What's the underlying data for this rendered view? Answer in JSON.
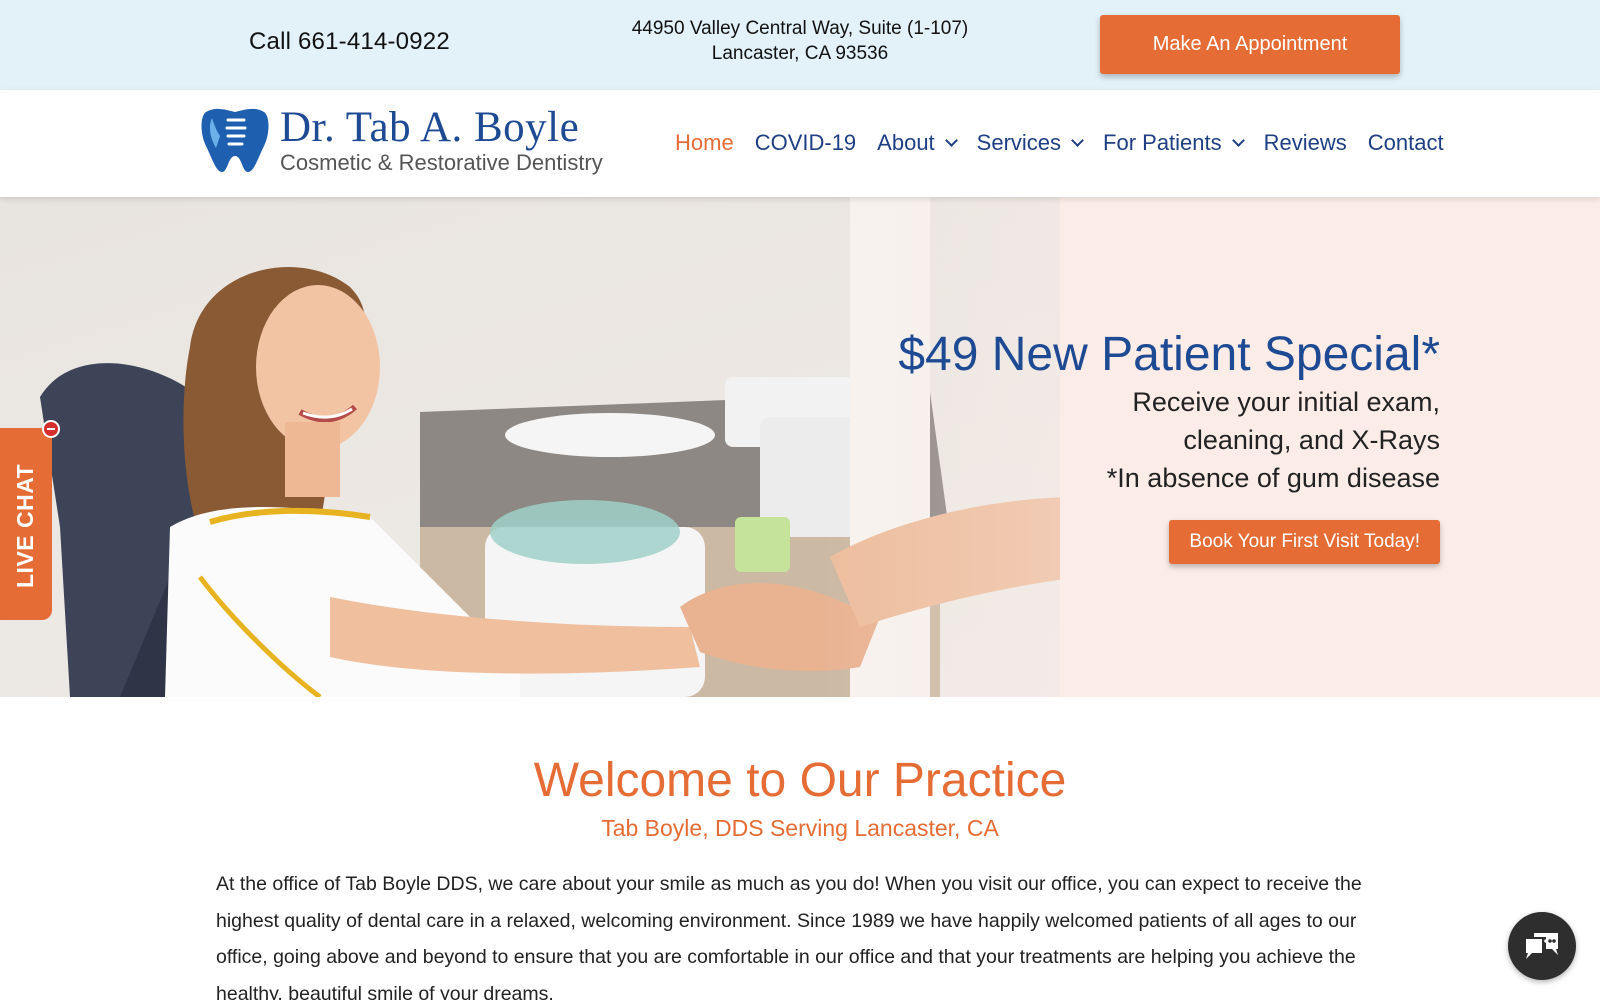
{
  "topbar": {
    "phone": "Call 661-414-0922",
    "address_line1": "44950 Valley Central Way, Suite (1-107)",
    "address_line2": "Lancaster, CA 93536",
    "appointment_button": "Make An Appointment"
  },
  "header": {
    "logo_name": "Dr. Tab A. Boyle",
    "logo_tagline": "Cosmetic & Restorative Dentistry",
    "nav": [
      {
        "label": "Home",
        "active": true
      },
      {
        "label": "COVID-19"
      },
      {
        "label": "About",
        "dropdown": true
      },
      {
        "label": "Services",
        "dropdown": true
      },
      {
        "label": "For Patients",
        "dropdown": true
      },
      {
        "label": "Reviews"
      },
      {
        "label": "Contact"
      }
    ]
  },
  "hero": {
    "promo_title": "$49 New Patient Special*",
    "promo_lines": [
      "Receive your initial exam,",
      "cleaning, and X-Rays",
      "*In absence of gum disease"
    ],
    "book_button": "Book Your First Visit Today!"
  },
  "live_chat": {
    "label": "LIVE CHAT"
  },
  "welcome": {
    "title": "Welcome to Our Practice",
    "subtitle": "Tab Boyle, DDS Serving Lancaster, CA",
    "body": "At the office of Tab Boyle DDS, we care about your smile as much as you do! When you visit our office, you can expect to receive the highest quality of dental care in a relaxed, welcoming environment. Since 1989 we have happily welcomed patients of all ages to our office, going above and beyond to ensure that you are comfortable in our office and that your treatments are helping you achieve the healthy, beautiful smile of your dreams."
  },
  "icons": {
    "logo": "tooth-icon",
    "chat": "chat-bubble-icon",
    "dropdown": "chevron-down-icon"
  },
  "colors": {
    "accent": "#e66c35",
    "brand_blue": "#1e4a94",
    "topbar_bg": "#e3f1f9"
  }
}
